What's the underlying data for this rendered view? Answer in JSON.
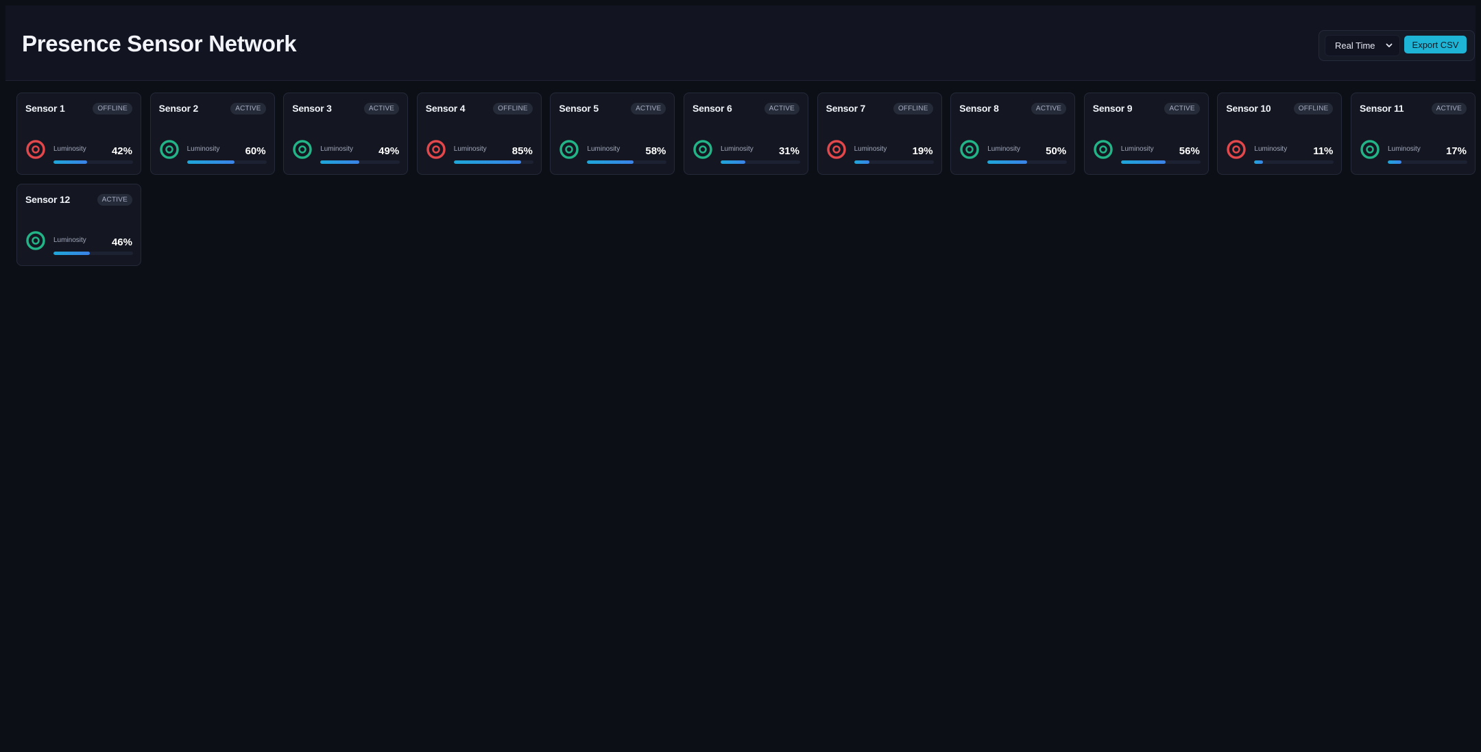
{
  "header": {
    "title": "Presence Sensor Network",
    "range_select": {
      "selected": "Real Time",
      "icon": "chevron-down-icon"
    },
    "export_label": "Export CSV"
  },
  "colors": {
    "active": "#22b486",
    "offline": "#e2474b",
    "accent": "#1eb4d6"
  },
  "sensors": [
    {
      "name": "Sensor 1",
      "status": "OFFLINE",
      "metric_label": "Luminosity",
      "value_text": "42%",
      "value": 42,
      "icon": "presence-target-icon"
    },
    {
      "name": "Sensor 2",
      "status": "ACTIVE",
      "metric_label": "Luminosity",
      "value_text": "60%",
      "value": 60,
      "icon": "presence-target-icon"
    },
    {
      "name": "Sensor 3",
      "status": "ACTIVE",
      "metric_label": "Luminosity",
      "value_text": "49%",
      "value": 49,
      "icon": "presence-target-icon"
    },
    {
      "name": "Sensor 4",
      "status": "OFFLINE",
      "metric_label": "Luminosity",
      "value_text": "85%",
      "value": 85,
      "icon": "presence-target-icon"
    },
    {
      "name": "Sensor 5",
      "status": "ACTIVE",
      "metric_label": "Luminosity",
      "value_text": "58%",
      "value": 58,
      "icon": "presence-target-icon"
    },
    {
      "name": "Sensor 6",
      "status": "ACTIVE",
      "metric_label": "Luminosity",
      "value_text": "31%",
      "value": 31,
      "icon": "presence-target-icon"
    },
    {
      "name": "Sensor 7",
      "status": "OFFLINE",
      "metric_label": "Luminosity",
      "value_text": "19%",
      "value": 19,
      "icon": "presence-target-icon"
    },
    {
      "name": "Sensor 8",
      "status": "ACTIVE",
      "metric_label": "Luminosity",
      "value_text": "50%",
      "value": 50,
      "icon": "presence-target-icon"
    },
    {
      "name": "Sensor 9",
      "status": "ACTIVE",
      "metric_label": "Luminosity",
      "value_text": "56%",
      "value": 56,
      "icon": "presence-target-icon"
    },
    {
      "name": "Sensor 10",
      "status": "OFFLINE",
      "metric_label": "Luminosity",
      "value_text": "11%",
      "value": 11,
      "icon": "presence-target-icon"
    },
    {
      "name": "Sensor 11",
      "status": "ACTIVE",
      "metric_label": "Luminosity",
      "value_text": "17%",
      "value": 17,
      "icon": "presence-target-icon"
    },
    {
      "name": "Sensor 12",
      "status": "ACTIVE",
      "metric_label": "Luminosity",
      "value_text": "46%",
      "value": 46,
      "icon": "presence-target-icon"
    }
  ]
}
